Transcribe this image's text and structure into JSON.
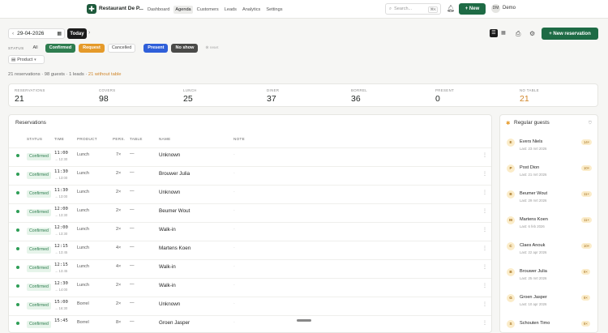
{
  "topbar": {
    "brand": "Restaurant De P...",
    "nav": [
      "Dashboard",
      "Agenda",
      "Customers",
      "Leads",
      "Analytics",
      "Settings"
    ],
    "active_nav": "Agenda",
    "search_placeholder": "Search...",
    "search_shortcut": "⌘K",
    "new_label": "+ New",
    "avatar_initials": "DM",
    "user_name": "Demo"
  },
  "toolbar": {
    "date_value": "29-04-2026",
    "today_label": "Today",
    "new_reservation_label": "+ New reservation"
  },
  "filters": {
    "status_label": "STATUS",
    "chips": [
      "All",
      "Confirmed",
      "Request",
      "Cancelled",
      "Present",
      "No show",
      "⊗ reset"
    ],
    "product_label": "Product"
  },
  "summary": {
    "text": "21 reservations · 98 guests · 1 leads · ",
    "warning": "21 without table"
  },
  "stats": [
    {
      "label": "RESERVATIONS",
      "value": "21"
    },
    {
      "label": "COVERS",
      "value": "98"
    },
    {
      "label": "LUNCH",
      "value": "25"
    },
    {
      "label": "DINER",
      "value": "37"
    },
    {
      "label": "BORREL",
      "value": "36"
    },
    {
      "label": "PRESENT",
      "value": "0"
    },
    {
      "label": "NO TABLE",
      "value": "21"
    }
  ],
  "reservations": {
    "title": "Reservations",
    "columns": [
      "STATUS",
      "TIME",
      "PRODUCT",
      "PERS.",
      "TABLE",
      "NAME",
      "NOTE"
    ],
    "rows": [
      {
        "status": "Confirmed",
        "time": "11:00",
        "end": "→ 12:30",
        "product": "Lunch",
        "pers": "7×",
        "table": "—",
        "name": "Unknown",
        "note": "·"
      },
      {
        "status": "Confirmed",
        "time": "11:30",
        "end": "→ 13:00",
        "product": "Lunch",
        "pers": "2×",
        "table": "—",
        "name": "Brouwer Julia",
        "note": "·"
      },
      {
        "status": "Confirmed",
        "time": "11:30",
        "end": "→ 13:00",
        "product": "Lunch",
        "pers": "2×",
        "table": "—",
        "name": "Unknown",
        "note": "·"
      },
      {
        "status": "Confirmed",
        "time": "12:00",
        "end": "→ 13:30",
        "product": "Lunch",
        "pers": "2×",
        "table": "—",
        "name": "Beumer Wout",
        "note": "·"
      },
      {
        "status": "Confirmed",
        "time": "12:00",
        "end": "→ 13:30",
        "product": "Lunch",
        "pers": "2×",
        "table": "—",
        "name": "Walk-in",
        "note": "·"
      },
      {
        "status": "Confirmed",
        "time": "12:15",
        "end": "→ 13:45",
        "product": "Lunch",
        "pers": "4×",
        "table": "—",
        "name": "Martens Koen",
        "note": "·"
      },
      {
        "status": "Confirmed",
        "time": "12:15",
        "end": "→ 13:45",
        "product": "Lunch",
        "pers": "4×",
        "table": "—",
        "name": "Walk-in",
        "note": "·"
      },
      {
        "status": "Confirmed",
        "time": "12:30",
        "end": "→ 14:00",
        "product": "Lunch",
        "pers": "2×",
        "table": "—",
        "name": "Walk-in",
        "note": "·"
      },
      {
        "status": "Confirmed",
        "time": "15:00",
        "end": "→ 16:30",
        "product": "Borrel",
        "pers": "2×",
        "table": "—",
        "name": "Unknown",
        "note": "·"
      },
      {
        "status": "Confirmed",
        "time": "15:45",
        "end": "",
        "product": "Borrel",
        "pers": "8×",
        "table": "—",
        "name": "Groen Jasper",
        "note": "·"
      }
    ]
  },
  "regulars": {
    "title": "Regular guests",
    "guests": [
      {
        "initial": "E",
        "name": "Evers Niels",
        "last": "Last: 23 mrt 2026",
        "count": "14×"
      },
      {
        "initial": "P",
        "name": "Post Dion",
        "last": "Last: 21 mrt 2026",
        "count": "10×"
      },
      {
        "initial": "B",
        "name": "Beumer Wout",
        "last": "Last: 29 mrt 2026",
        "count": "11×"
      },
      {
        "initial": "M",
        "name": "Martens Koen",
        "last": "Last: 6 feb 2026",
        "count": "11×"
      },
      {
        "initial": "C",
        "name": "Claes Anouk",
        "last": "Last: 22 apr 2026",
        "count": "10×"
      },
      {
        "initial": "B",
        "name": "Brouwer Julia",
        "last": "Last: 25 mrt 2026",
        "count": "9×"
      },
      {
        "initial": "G",
        "name": "Groen Jasper",
        "last": "Last: 10 apr 2026",
        "count": "9×"
      },
      {
        "initial": "S",
        "name": "Schouten Timo",
        "last": "",
        "count": "9×"
      }
    ]
  },
  "colors": {
    "brand": "#1e6b45",
    "confirmed": "#2e7d4f",
    "request": "#e59a2a",
    "present": "#2f5fd9",
    "warning": "#d0862a"
  }
}
